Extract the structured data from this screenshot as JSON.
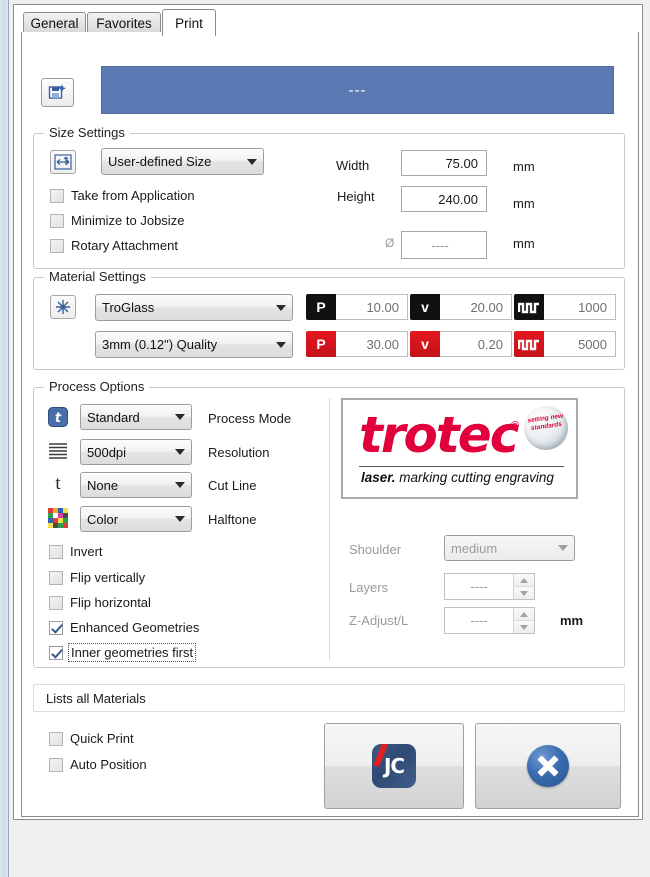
{
  "tabs": [
    {
      "label": "General",
      "active": false
    },
    {
      "label": "Favorites",
      "active": false
    },
    {
      "label": "Print",
      "active": true
    }
  ],
  "header": {
    "title_value": "---",
    "save_icon": "save-new-icon",
    "accent_color": "#5b7ab4"
  },
  "size_settings": {
    "title": "Size Settings",
    "size_icon": "resize-icon",
    "size_preset": "User-defined Size",
    "width_label": "Width",
    "width_value": "75.00",
    "width_unit": "mm",
    "height_label": "Height",
    "height_value": "240.00",
    "height_unit": "mm",
    "diameter_symbol": "Ø",
    "diameter_value": "----",
    "diameter_unit": "mm",
    "checkboxes": [
      {
        "label": "Take from Application",
        "checked": false
      },
      {
        "label": "Minimize to Jobsize",
        "checked": false
      },
      {
        "label": "Rotary Attachment",
        "checked": false
      }
    ]
  },
  "material_settings": {
    "title": "Material Settings",
    "material_icon": "laser-settings-icon",
    "material": "TroGlass",
    "thickness": "3mm (0.12\") Quality",
    "engrave_row": {
      "power_badge": "P",
      "power_value": "10.00",
      "speed_badge": "v",
      "speed_value": "20.00",
      "ppi_badge": "ppi-wave-icon",
      "ppi_value": "1000"
    },
    "cut_row": {
      "power_badge": "P",
      "power_value": "30.00",
      "speed_badge": "v",
      "speed_value": "0.20",
      "ppi_badge": "ppi-wave-icon",
      "ppi_value": "5000"
    }
  },
  "process_options": {
    "title": "Process Options",
    "rows": [
      {
        "icon": "process-mode-icon",
        "value": "Standard",
        "label": "Process Mode"
      },
      {
        "icon": "resolution-lines-icon",
        "value": "500dpi",
        "label": "Resolution"
      },
      {
        "icon": "cutline-t-icon",
        "value": "None",
        "label": "Cut Line"
      },
      {
        "icon": "halftone-color-grid-icon",
        "value": "Color",
        "label": "Halftone"
      }
    ],
    "checkboxes": [
      {
        "label": "Invert",
        "checked": false,
        "focused": false
      },
      {
        "label": "Flip vertically",
        "checked": false,
        "focused": false
      },
      {
        "label": "Flip horizontal",
        "checked": false,
        "focused": false
      },
      {
        "label": "Enhanced Geometries",
        "checked": true,
        "focused": false
      },
      {
        "label": "Inner geometries first",
        "checked": true,
        "focused": true
      }
    ],
    "logo": {
      "word": "trotec",
      "registered": "®",
      "tagline_bold": "laser.",
      "tagline_rest": " marking cutting engraving",
      "sphere_text": "setting new standards",
      "color": "#e2003c"
    },
    "shoulder_label": "Shoulder",
    "shoulder_value": "medium",
    "layers_label": "Layers",
    "layers_value": "----",
    "zadjust_label": "Z-Adjust/L",
    "zadjust_value": "----",
    "zadjust_unit": "mm"
  },
  "footer": {
    "lists_all_materials": "Lists all Materials",
    "checkboxes": [
      {
        "label": "Quick Print",
        "checked": false
      },
      {
        "label": "Auto Position",
        "checked": false
      }
    ],
    "jobcontrol_button": {
      "icon": "jobcontrol-icon",
      "text": "JC"
    },
    "cancel_button": {
      "icon": "cancel-x-icon"
    }
  }
}
